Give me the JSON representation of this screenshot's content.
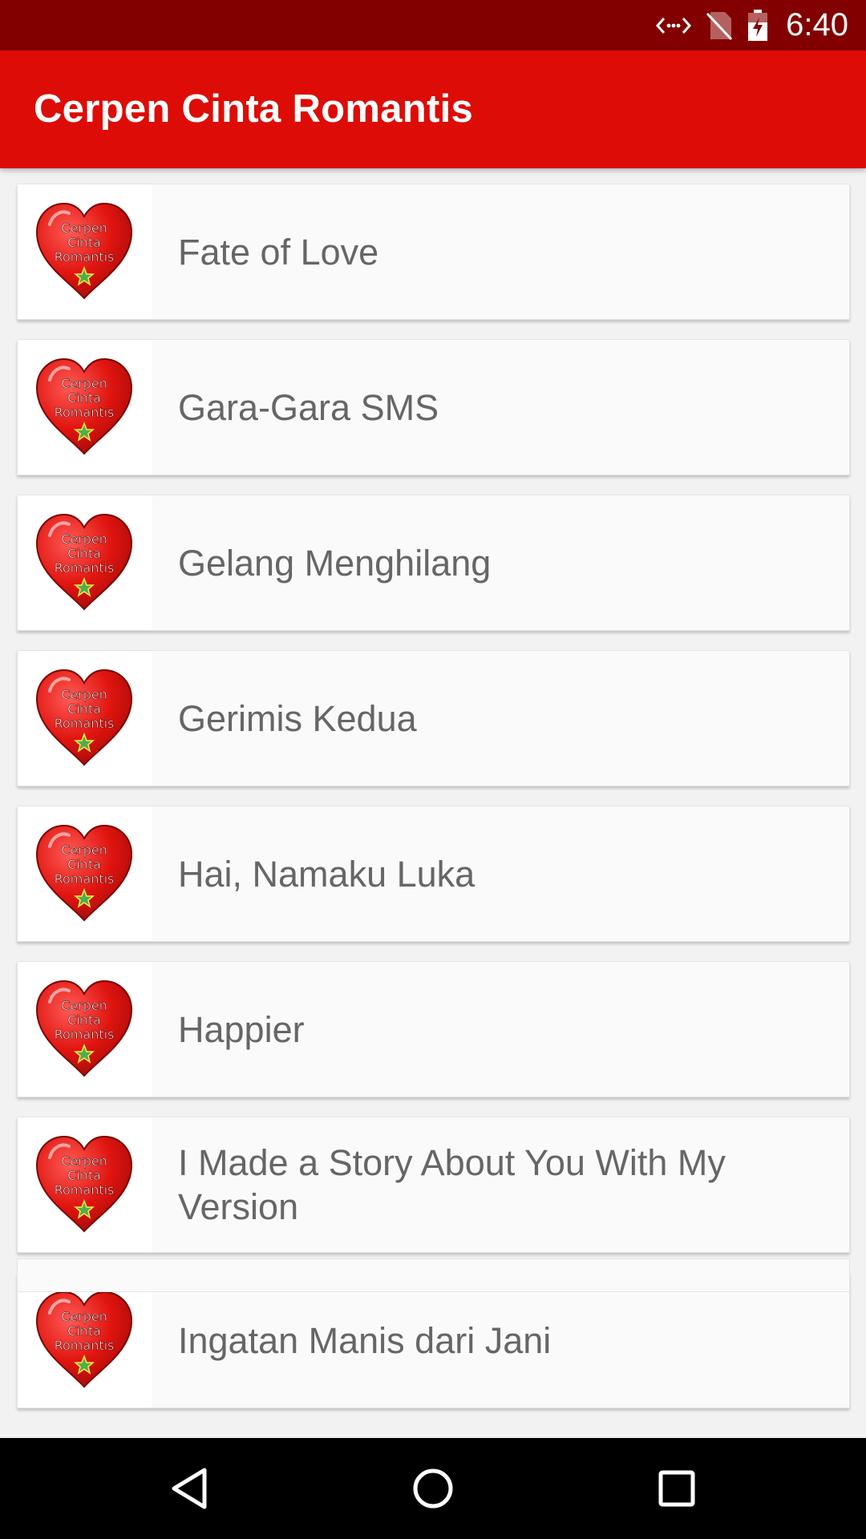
{
  "status_bar": {
    "time": "6:40",
    "icons": [
      "data-sync-icon",
      "no-sim-icon",
      "battery-charging-icon"
    ]
  },
  "app_bar": {
    "title": "Cerpen Cinta Romantis"
  },
  "thumbnail": {
    "text_line1": "Cerpen",
    "text_line2": "Cinta",
    "text_line3": "Romantis",
    "heart_color": "#d80f12",
    "star_color": "#4caf50"
  },
  "stories": [
    {
      "title": "Fate of Love"
    },
    {
      "title": "Gara-Gara SMS"
    },
    {
      "title": "Gelang Menghilang"
    },
    {
      "title": "Gerimis Kedua"
    },
    {
      "title": "Hai, Namaku Luka"
    },
    {
      "title": "Happier"
    },
    {
      "title": "I Made a Story About You With My Version"
    },
    {
      "title": "Ingatan Manis dari Jani"
    }
  ],
  "nav_bar": {
    "buttons": [
      "back-icon",
      "home-icon",
      "recents-icon"
    ]
  },
  "colors": {
    "status_bar": "#830000",
    "app_bar": "#dd0c06",
    "list_bg": "#f2f2f2",
    "card_text": "#666666"
  }
}
